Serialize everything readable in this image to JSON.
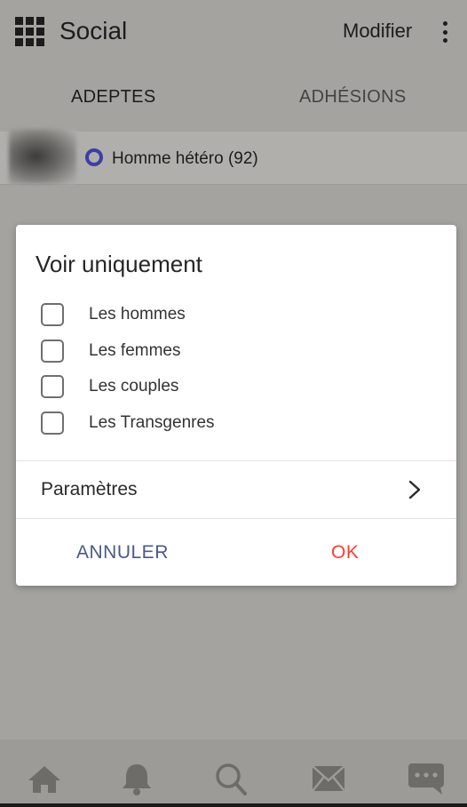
{
  "header": {
    "title": "Social",
    "modifier_label": "Modifier"
  },
  "tabs": [
    {
      "label": "ADEPTES",
      "active": true
    },
    {
      "label": "ADHÉSIONS",
      "active": false
    }
  ],
  "filter": {
    "label": "Homme hétéro (92)"
  },
  "dialog": {
    "title": "Voir uniquement",
    "options": [
      {
        "label": "Les hommes",
        "checked": false
      },
      {
        "label": "Les femmes",
        "checked": false
      },
      {
        "label": "Les couples",
        "checked": false
      },
      {
        "label": "Les Transgenres",
        "checked": false
      }
    ],
    "settings_label": "Paramètres",
    "cancel_label": "ANNULER",
    "ok_label": "OK"
  },
  "bottom_nav": [
    {
      "icon": "home-icon"
    },
    {
      "icon": "bell-icon"
    },
    {
      "icon": "search-icon"
    },
    {
      "icon": "mail-icon"
    },
    {
      "icon": "chat-icon"
    }
  ],
  "colors": {
    "overlay_bg": "#a4a3a0",
    "accent_radio": "#3c3fa5",
    "cancel": "#4a5a86",
    "ok": "#ff3b30"
  }
}
